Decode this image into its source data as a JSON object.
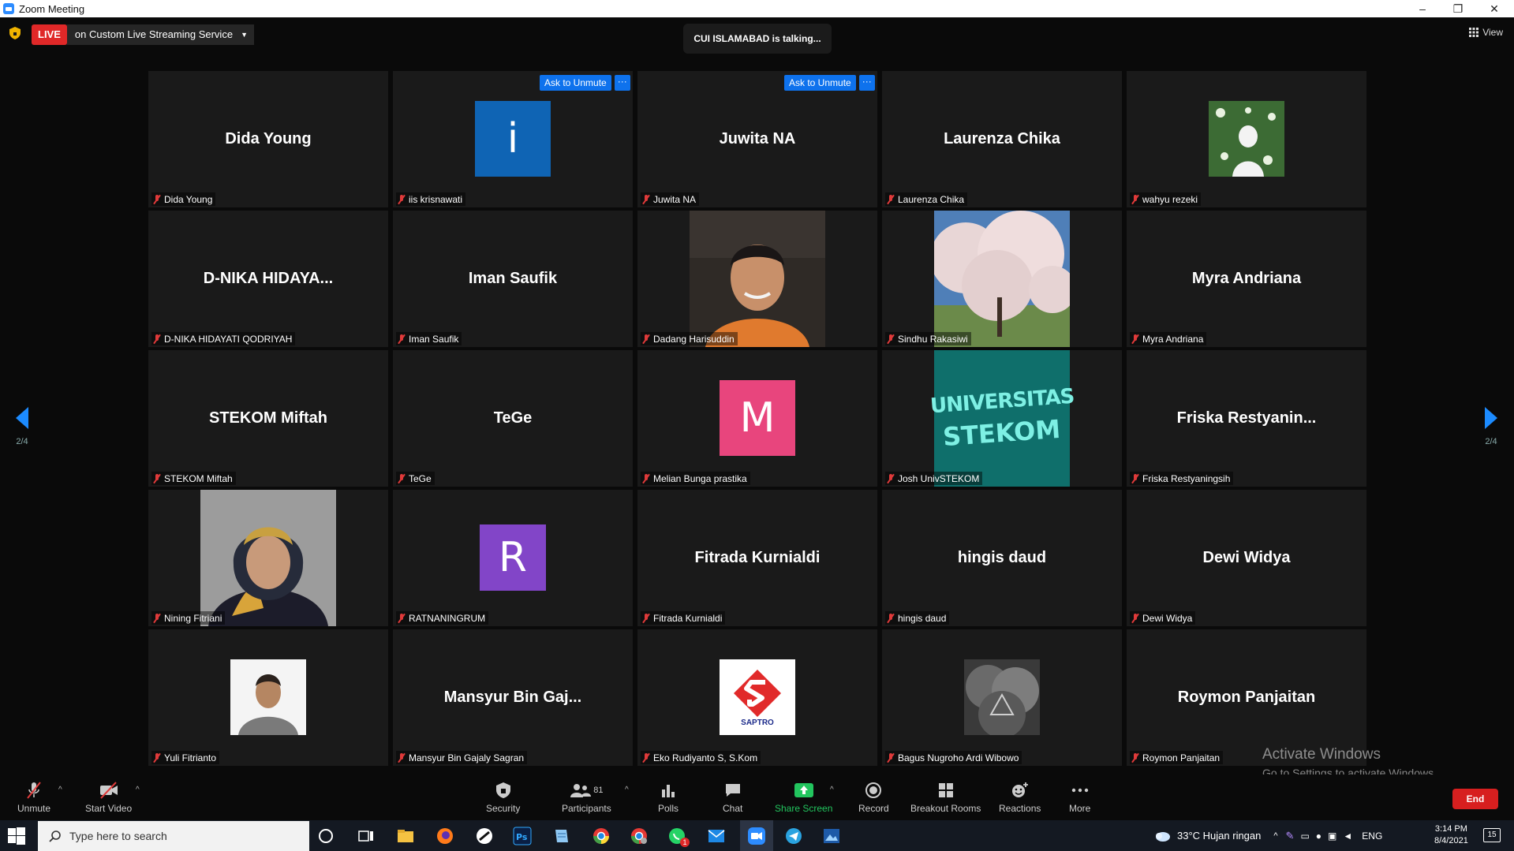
{
  "window": {
    "title": "Zoom Meeting",
    "controls": [
      "–",
      "❐",
      "✕"
    ]
  },
  "topbar": {
    "live_badge": "LIVE",
    "live_text": "on Custom Live Streaming Service",
    "talking": "CUI ISLAMABAD is talking...",
    "view_label": "View"
  },
  "pager": {
    "left": "2/4",
    "right": "2/4"
  },
  "ask_unmute": {
    "label": "Ask to Unmute",
    "more": "···"
  },
  "participants": [
    {
      "big": "Dida Young",
      "label": "Dida Young"
    },
    {
      "big": "",
      "label": "iis krisnawati",
      "letter": "i",
      "color": "#0f64b4"
    },
    {
      "big": "Juwita NA",
      "label": "Juwita NA"
    },
    {
      "big": "Laurenza Chika",
      "label": "Laurenza Chika"
    },
    {
      "big": "",
      "label": "wahyu rezeki"
    },
    {
      "big": "D-NIKA  HIDAYA...",
      "label": "D-NIKA HIDAYATI QODRIYAH"
    },
    {
      "big": "Iman Saufik",
      "label": "Iman Saufik"
    },
    {
      "big": "",
      "label": "Dadang Harisuddin"
    },
    {
      "big": "",
      "label": "Sindhu Rakasiwi"
    },
    {
      "big": "Myra Andriana",
      "label": "Myra Andriana"
    },
    {
      "big": "STEKOM Miftah",
      "label": "STEKOM Miftah"
    },
    {
      "big": "TeGe",
      "label": "TeGe"
    },
    {
      "big": "",
      "label": "Melian Bunga prastika",
      "letter": "M",
      "color": "#e8457d"
    },
    {
      "big": "",
      "label": "Josh UnivSTEKOM",
      "image_text": [
        "UNIVERSITAS",
        "STEKOM"
      ]
    },
    {
      "big": "Friska  Restyanin...",
      "label": "Friska Restyaningsih"
    },
    {
      "big": "",
      "label": "Nining Fitriani"
    },
    {
      "big": "",
      "label": "RATNANINGRUM",
      "letter": "R",
      "color": "#8245c8"
    },
    {
      "big": "Fitrada Kurnialdi",
      "label": "Fitrada Kurnialdi"
    },
    {
      "big": "hingis daud",
      "label": "hingis daud"
    },
    {
      "big": "Dewi Widya",
      "label": "Dewi Widya"
    },
    {
      "big": "",
      "label": "Yuli Fitrianto"
    },
    {
      "big": "Mansyur Bin Gaj...",
      "label": "Mansyur Bin Gajaly Sagran"
    },
    {
      "big": "",
      "label": "Eko Rudiyanto S, S.Kom",
      "image_text": [
        "SAPTRO"
      ]
    },
    {
      "big": "",
      "label": "Bagus Nugroho Ardi Wibowo"
    },
    {
      "big": "Roymon Panjaitan",
      "label": "Roymon Panjaitan"
    }
  ],
  "watermark": {
    "line1": "Activate Windows",
    "line2": "Go to Settings to activate Windows."
  },
  "toolbar": {
    "unmute": "Unmute",
    "start_video": "Start Video",
    "security": "Security",
    "participants": "Participants",
    "participants_count": "81",
    "polls": "Polls",
    "chat": "Chat",
    "share_screen": "Share Screen",
    "record": "Record",
    "breakout_rooms": "Breakout Rooms",
    "reactions": "Reactions",
    "more": "More",
    "end": "End"
  },
  "taskbar": {
    "search_placeholder": "Type here to search",
    "weather": "33°C  Hujan ringan",
    "lang": "ENG",
    "time": "3:14 PM",
    "date": "8/4/2021",
    "notif_count": "15",
    "chat_badge": "1"
  },
  "colors": {
    "live": "#e02828",
    "accent": "#0e72ed",
    "share_screen": "#22c55e",
    "end": "#d71f1f"
  }
}
